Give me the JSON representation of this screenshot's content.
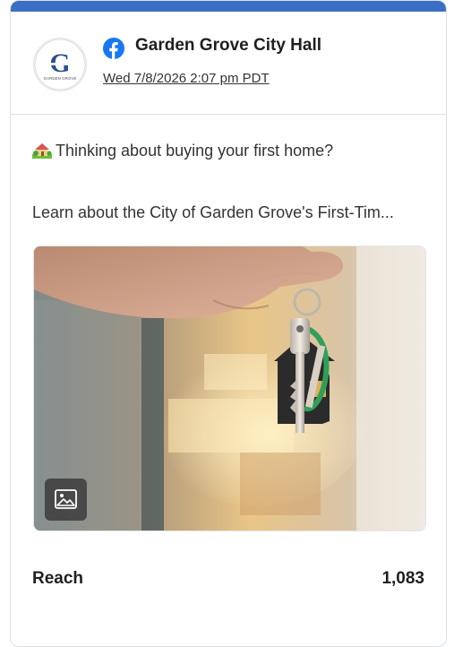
{
  "post": {
    "account_name": "Garden Grove City Hall",
    "platform_icon": "facebook-icon",
    "date": "Wed 7/8/2026 2:07 pm PDT",
    "logo_text": "Garden Grove",
    "emoji": "house-with-garden",
    "text_line1": "Thinking about buying your first home?",
    "text_line2": "Learn about the City of Garden Grove's First-Tim...",
    "media_badge_icon": "image-icon"
  },
  "metrics": {
    "reach_label": "Reach",
    "reach_value": "1,083"
  },
  "colors": {
    "accent_bar": "#3b6fc4",
    "facebook_blue": "#1877f2"
  }
}
